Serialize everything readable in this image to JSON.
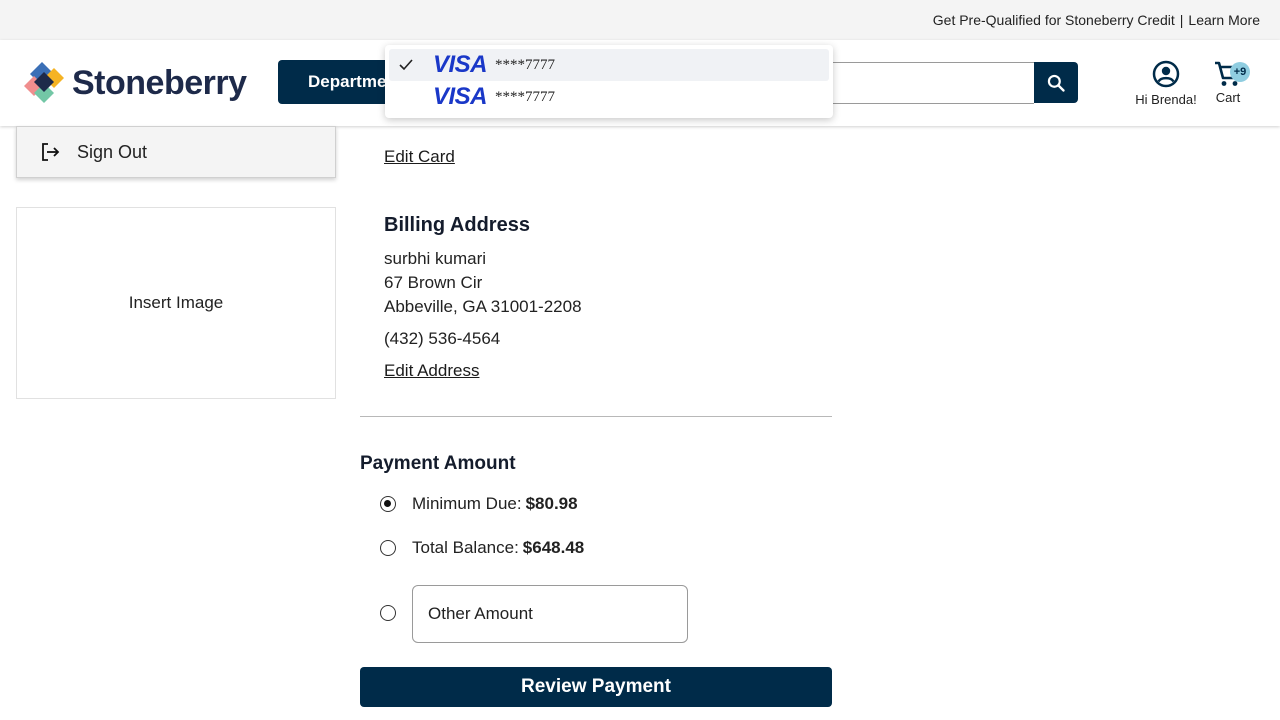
{
  "promo": {
    "prequal_text": "Get Pre-Qualified for Stoneberry Credit",
    "separator": "|",
    "learn_more": "Learn More"
  },
  "header": {
    "logo_text": "Stoneberry",
    "departments_label": "Departments",
    "search_placeholder": "",
    "account_label": "Hi Brenda!",
    "cart_label": "Cart",
    "cart_badge": "+9"
  },
  "card_dropdown": {
    "options": [
      {
        "brand": "VISA",
        "masked_number": "****7777",
        "selected": true
      },
      {
        "brand": "VISA",
        "masked_number": "****7777",
        "selected": false
      }
    ]
  },
  "sidebar": {
    "sign_out_label": "Sign Out",
    "insert_image_label": "Insert Image"
  },
  "payment_method": {
    "edit_card_link": "Edit Card"
  },
  "billing": {
    "heading": "Billing Address",
    "name": "surbhi kumari",
    "street": "67 Brown Cir",
    "city_state_zip": "Abbeville, GA 31001-2208",
    "phone": "(432) 536-4564",
    "edit_address_link": "Edit Address"
  },
  "payment_amount": {
    "heading": "Payment Amount",
    "options": [
      {
        "label": "Minimum Due:",
        "amount": "$80.98",
        "selected": true
      },
      {
        "label": "Total Balance:",
        "amount": "$648.48",
        "selected": false
      }
    ],
    "other_amount_placeholder": "Other Amount",
    "review_button": "Review Payment"
  },
  "colors": {
    "brand_navy": "#002b49",
    "visa_blue": "#1a38c8",
    "badge_blue": "#8fcde0"
  }
}
